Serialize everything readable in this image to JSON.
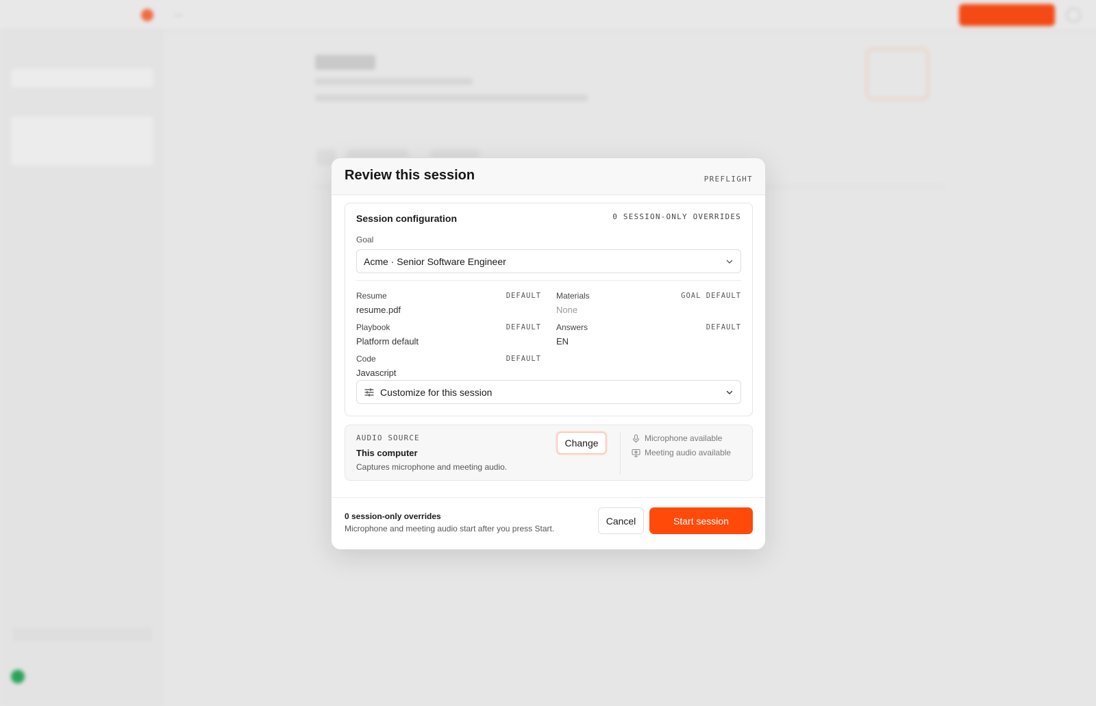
{
  "modal": {
    "title": "Review this session",
    "badge": "PREFLIGHT"
  },
  "config": {
    "title": "Session configuration",
    "overrides_badge": "0 SESSION-ONLY OVERRIDES",
    "goal_label": "Goal",
    "goal_value": "Acme · Senior Software Engineer",
    "fields": [
      {
        "label": "Resume",
        "tag": "DEFAULT",
        "value": "resume.pdf"
      },
      {
        "label": "Materials",
        "tag": "GOAL DEFAULT",
        "value": "None"
      },
      {
        "label": "Playbook",
        "tag": "DEFAULT",
        "value": "Platform default"
      },
      {
        "label": "Answers",
        "tag": "DEFAULT",
        "value": "EN"
      },
      {
        "label": "Code",
        "tag": "DEFAULT",
        "value": "Javascript"
      }
    ],
    "customize_label": "Customize for this session"
  },
  "audio": {
    "section_label": "AUDIO SOURCE",
    "source_name": "This computer",
    "source_desc": "Captures microphone and meeting audio.",
    "change_label": "Change",
    "status": [
      {
        "icon": "microphone-icon",
        "text": "Microphone available"
      },
      {
        "icon": "monitor-audio-icon",
        "text": "Meeting audio available"
      }
    ]
  },
  "footer": {
    "summary_title": "0 session-only overrides",
    "summary_desc": "Microphone and meeting audio start after you press Start.",
    "cancel_label": "Cancel",
    "start_label": "Start session"
  },
  "colors": {
    "accent": "#ff4a0a",
    "backdrop": "#e6e6e6"
  }
}
